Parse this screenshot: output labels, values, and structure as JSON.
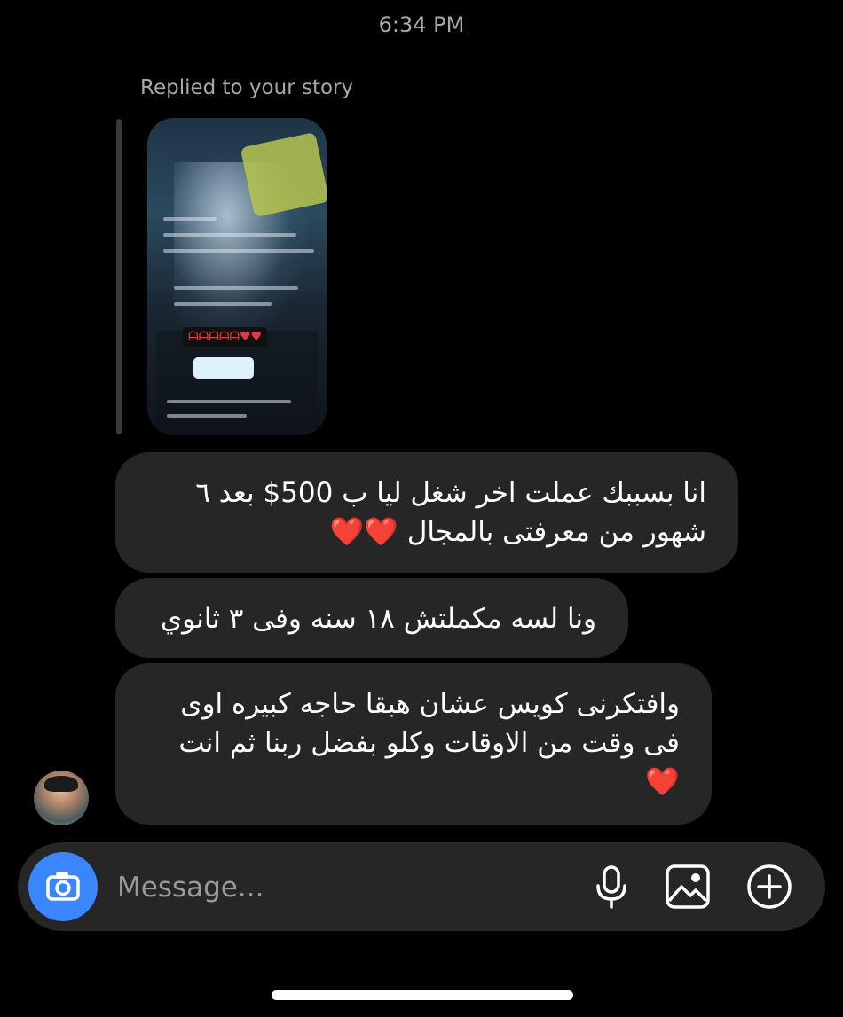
{
  "status": {
    "time": "6:34 PM"
  },
  "reply": {
    "label": "Replied to your story"
  },
  "messages": [
    {
      "lines": [
        "انا بسببك عملت اخر شغل ليا ب 500$ بعد ٦",
        "شهور من معرفتى بالمجال"
      ],
      "emoji": "❤️❤️"
    },
    {
      "lines": [
        "ونا لسه مكملتش ١٨ سنه وفى ٣ ثانوي"
      ]
    },
    {
      "lines": [
        "وافتكرنى كويس عشان هبقا حاجه كبيره اوى",
        "فى وقت من الاوقات وكلو بفضل ربنا ثم انت"
      ],
      "emoji": "❤️"
    }
  ],
  "composer": {
    "placeholder": "Message..."
  },
  "colors": {
    "camera_button": "#3a86ff",
    "bubble": "#262626",
    "background": "#000000"
  },
  "icons": [
    "camera-icon",
    "microphone-icon",
    "gallery-icon",
    "add-circle-icon"
  ]
}
